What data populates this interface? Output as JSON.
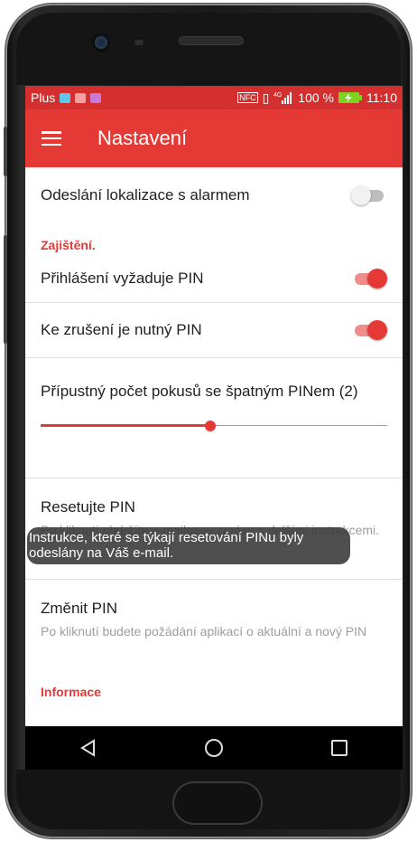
{
  "status_bar": {
    "carrier": "Plus",
    "battery": "100 %",
    "time": "11:10",
    "nfc": "NFC",
    "signal": "4G"
  },
  "app_bar": {
    "title": "Nastavení",
    "menu_icon": "hamburger-menu-icon"
  },
  "settings": {
    "location_row": {
      "label": "Odeslání lokalizace s alarmem",
      "enabled": false
    },
    "section_security": "Zajištění.",
    "login_pin_row": {
      "label": "Přihlášení vyžaduje PIN",
      "enabled": true
    },
    "cancel_pin_row": {
      "label": "Ke zrušení je nutný PIN",
      "enabled": true
    },
    "attempts_slider": {
      "label": "Přípustný počet pokusů se špatným PINem (2)",
      "value_fraction": 0.49
    },
    "reset_pin": {
      "title": "Resetujte PIN",
      "summary": "Po kliknutí obdržíte e-mailovou zprávu s dalšími instrukcemi."
    },
    "change_pin": {
      "title": "Změnit PIN",
      "summary": "Po kliknutí budete požádání aplikací o aktuální a nový PIN"
    },
    "section_info": "Informace"
  },
  "toast": {
    "line1": "Instrukce, které se týkají resetování PINu byly",
    "line2": "odeslány na Váš e-mail."
  },
  "nav_bar": {
    "back": "back-triangle-icon",
    "home": "home-circle-icon",
    "recents": "recents-square-icon"
  },
  "colors": {
    "accent": "#e53935",
    "status_bar": "#d32f2f",
    "toast": "#3c3c3c"
  }
}
